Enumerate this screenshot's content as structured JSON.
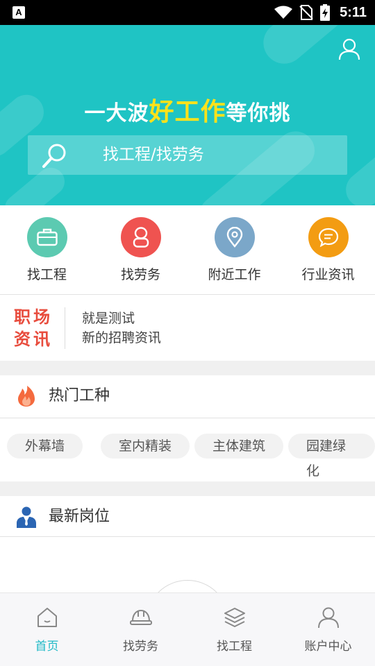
{
  "status_bar": {
    "time": "5:11",
    "notification_icon": "A"
  },
  "header": {
    "slogan_prefix": "一大波",
    "slogan_highlight": "好工作",
    "slogan_suffix": "等你挑",
    "search_placeholder": "找工程/找劳务"
  },
  "categories": [
    {
      "label": "找工程",
      "icon": "briefcase-icon",
      "color": "#5ccab1"
    },
    {
      "label": "找劳务",
      "icon": "person-icon",
      "color": "#ef5350"
    },
    {
      "label": "附近工作",
      "icon": "location-pin-icon",
      "color": "#7ba7c9"
    },
    {
      "label": "行业资讯",
      "icon": "chat-icon",
      "color": "#f39c12"
    }
  ],
  "news": {
    "badge_line1": "职场",
    "badge_line2": "资讯",
    "items": [
      "就是测试",
      "新的招聘资讯"
    ]
  },
  "hot_jobs": {
    "title": "热门工种",
    "tags": [
      "外幕墙",
      "室内精装",
      "主体建筑",
      "园建绿化"
    ]
  },
  "latest_positions": {
    "title": "最新岗位"
  },
  "tabbar": {
    "items": [
      {
        "label": "首页",
        "icon": "home-icon",
        "active": true
      },
      {
        "label": "找劳务",
        "icon": "helmet-icon",
        "active": false
      },
      {
        "label": "找工程",
        "icon": "layers-icon",
        "active": false
      },
      {
        "label": "账户中心",
        "icon": "account-icon",
        "active": false
      }
    ]
  },
  "colors": {
    "accent": "#1fc4c4",
    "highlight": "#ffe21a",
    "news_badge": "#e84c3d",
    "active_tab": "#1fb9c6"
  }
}
